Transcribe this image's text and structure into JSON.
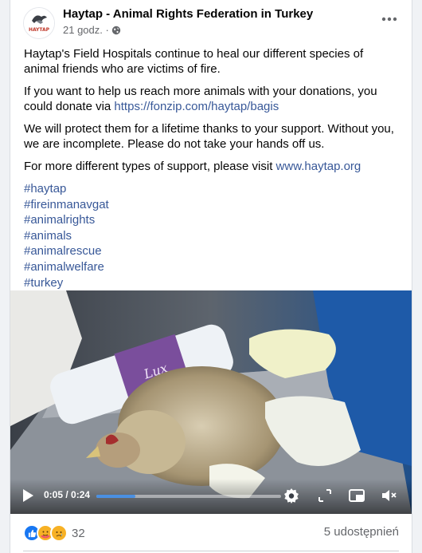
{
  "post": {
    "page_name": "Haytap - Animal Rights Federation in Turkey",
    "time": "21 godz. ·",
    "avatar_text": "HAYTAP",
    "paragraphs": {
      "p1": "Haytap's Field Hospitals continue to heal our different species of animal friends who are victims of fire.",
      "p2_text": "If you want to help us reach more animals with your donations, you could donate via ",
      "p2_link": "https://fonzip.com/haytap/bagis",
      "p3": "We will protect them for a lifetime thanks to your support. Without you, we are incomplete. Please do not take your hands off us.",
      "p4_text": "For more different types of support, please visit ",
      "p4_link": "www.haytap.org"
    },
    "hashtags": [
      "#haytap",
      "#fireinmanavgat",
      "#animalrights",
      "#animals",
      "#animalrescue",
      "#animalwelfare",
      "#turkey"
    ]
  },
  "video": {
    "current_time": "0:05",
    "duration": "0:24",
    "time_display": "0:05 / 0:24",
    "progress_percent": 21,
    "product_label": "Lux"
  },
  "footer": {
    "reaction_count": "32",
    "shares": "5 udostępnień",
    "reactions": [
      "like",
      "care",
      "sad"
    ]
  },
  "icons": {
    "globe": "globe-icon",
    "more": "more-options-icon",
    "play": "play-icon",
    "settings": "settings-icon",
    "fullscreen": "fullscreen-icon",
    "pip": "picture-in-picture-icon",
    "volume": "volume-muted-icon"
  },
  "colors": {
    "link": "#385898",
    "like": "#1877f2",
    "emoji": "#f7b125",
    "progress": "#4a90e2"
  }
}
